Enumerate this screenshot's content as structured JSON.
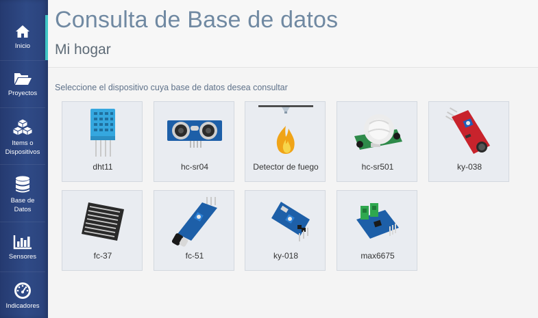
{
  "sidebar": {
    "items": [
      {
        "label": "Inicio",
        "icon": "home-icon"
      },
      {
        "label": "Proyectos",
        "icon": "folder-icon"
      },
      {
        "label": "Items o Dispositivos",
        "icon": "cubes-icon"
      },
      {
        "label": "Base de Datos",
        "icon": "database-icon"
      },
      {
        "label": "Sensores",
        "icon": "bar-chart-icon"
      },
      {
        "label": "Indicadores",
        "icon": "gauge-icon"
      }
    ]
  },
  "header": {
    "title": "Consulta de Base de datos",
    "subtitle": "Mi hogar"
  },
  "main": {
    "instruction": "Seleccione el dispositivo cuya base de datos desea consultar",
    "devices": [
      {
        "label": "dht11"
      },
      {
        "label": "hc-sr04"
      },
      {
        "label": "Detector de fuego"
      },
      {
        "label": "hc-sr501"
      },
      {
        "label": "ky-038"
      },
      {
        "label": "fc-37"
      },
      {
        "label": "fc-51"
      },
      {
        "label": "ky-018"
      },
      {
        "label": "max6675"
      }
    ]
  },
  "colors": {
    "sidebar": "#2a427b",
    "accent": "#3fc5c5",
    "title": "#7089a2",
    "card_bg": "#e9ecf1"
  }
}
